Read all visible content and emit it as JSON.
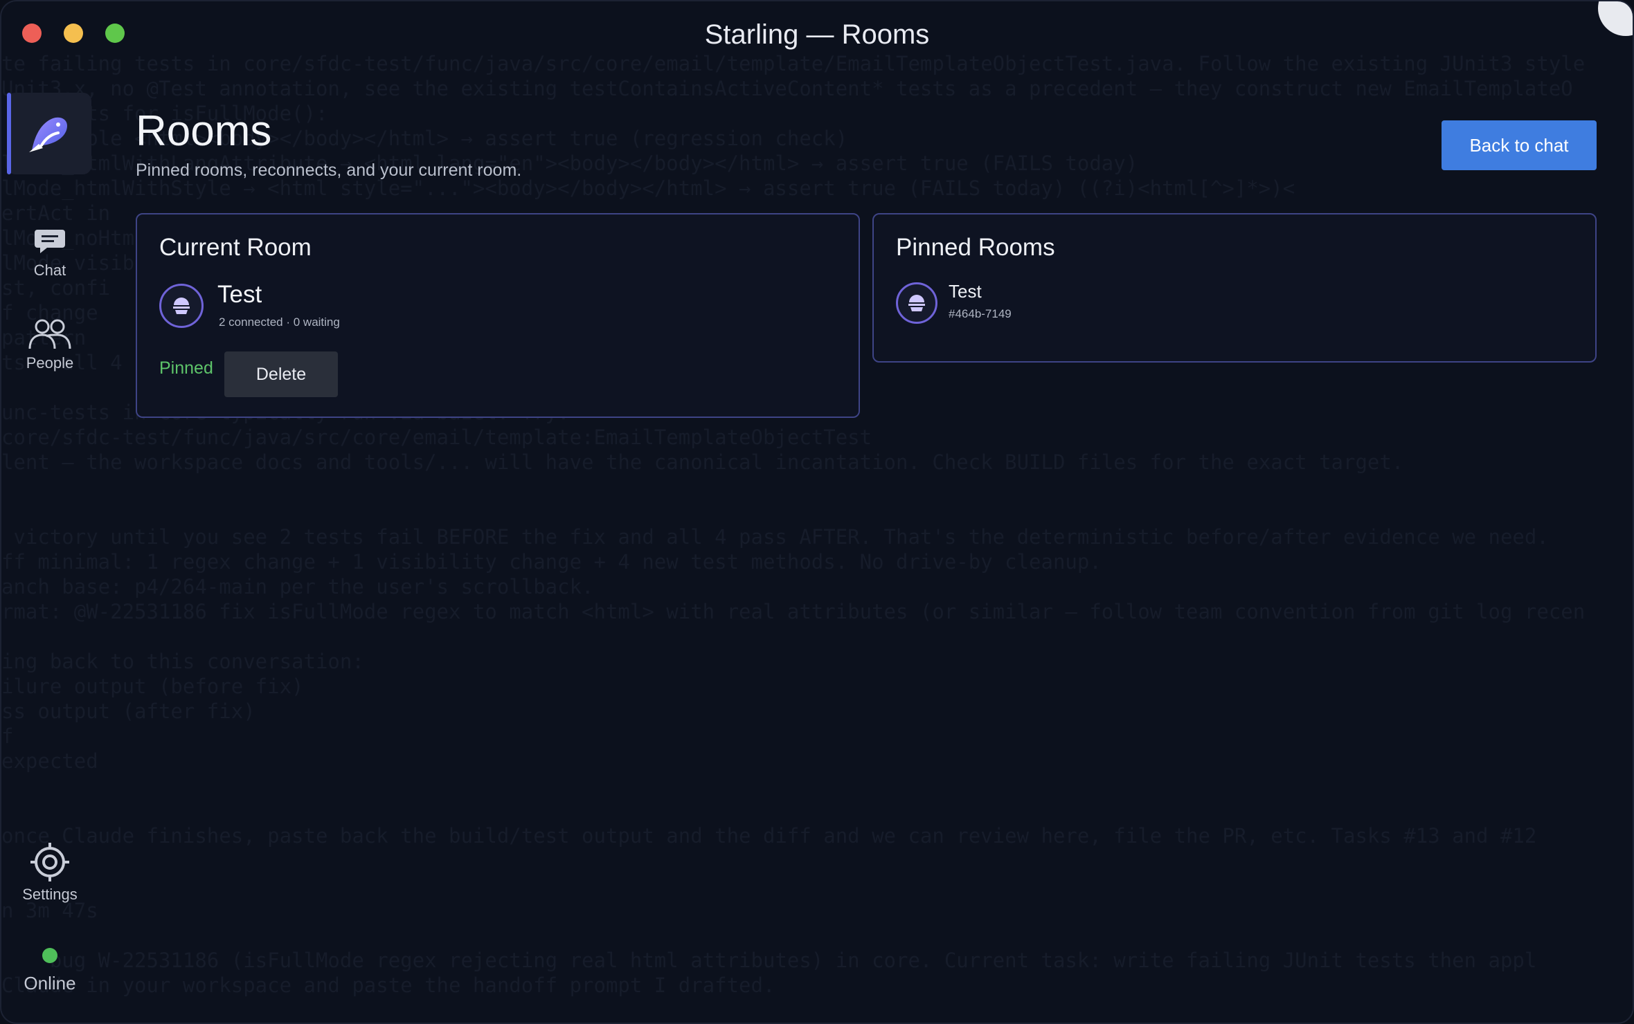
{
  "window": {
    "title": "Starling — Rooms"
  },
  "sidebar": {
    "items": [
      {
        "label": "Chat",
        "icon": "chat-icon"
      },
      {
        "label": "People",
        "icon": "people-icon"
      },
      {
        "label": "Settings",
        "icon": "gear-icon"
      }
    ],
    "status": {
      "label": "Online",
      "color": "#4fbf5a"
    }
  },
  "header": {
    "title": "Rooms",
    "subtitle": "Pinned rooms, reconnects, and your current room.",
    "back_button": "Back to chat"
  },
  "current_room": {
    "heading": "Current Room",
    "name": "Test",
    "meta": "2 connected · 0 waiting",
    "pinned_label": "Pinned",
    "delete_button": "Delete"
  },
  "pinned_rooms": {
    "heading": "Pinned Rooms",
    "items": [
      {
        "name": "Test",
        "id": "#464b-7149"
      }
    ]
  },
  "background_text": [
    "te failing tests in core/sfdc-test/func/java/src/core/email/template/EmailTemplateObjectTest.java. Follow the existing JUnit3 style",
    "Unit3.x, no @Test annotation, see the existing testContainsActiveContent* tests as a precedent — they construct new EmailTemplateO",
    "    tests for isFullMode():",
    "    simple <html><body></body></html> → assert true (regression check)",
    "lMode_htmlWithLangAttribute → <html lang=\"en\"><body></body></html> → assert true (FAILS today)",
    "lMode_htmlWithStyle → <html style=\"...\"><body></body></html> → assert true (FAILS today) ((?i)<html[^>]*>)<",
    "ertAct in",
    "lMode_noHtml",
    "lMode visib",
    "st, confi",
    "f change",
    "pattern",
    "ts — all 4",
    "",
    "unc-tests in core typically run via bazel. Try:",
    "core/sfdc-test/func/java/src/core/email/template:EmailTemplateObjectTest",
    "lent — the workspace docs and tools/... will have the canonical incantation. Check BUILD files for the exact target.",
    "",
    "",
    " victory until you see 2 tests fail BEFORE the fix and all 4 pass AFTER. That's the deterministic before/after evidence we need.",
    "ff minimal: 1 regex change + 1 visibility change + 4 new test methods. No drive-by cleanup.",
    "anch base: p4/264-main per the user's scrollback.",
    "rmat: @W-22531186 fix isFullMode regex to match <html> with real attributes (or similar — follow team convention from git log recen",
    "",
    "ing back to this conversation:",
    "ilure output (before fix)",
    "ss output (after fix)",
    "f",
    "expected",
    "",
    "",
    "once Claude finishes, paste back the build/test output and the diff and we can review here, file the PR, etc. Tasks #13 and #12",
    "",
    "",
    "n 3m 47s",
    "",
    "    bug W-22531186 (isFullMode regex rejecting real html attributes) in core. Current task: write failing JUnit tests then appl",
    "Claude in your workspace and paste the handoff prompt I drafted."
  ]
}
